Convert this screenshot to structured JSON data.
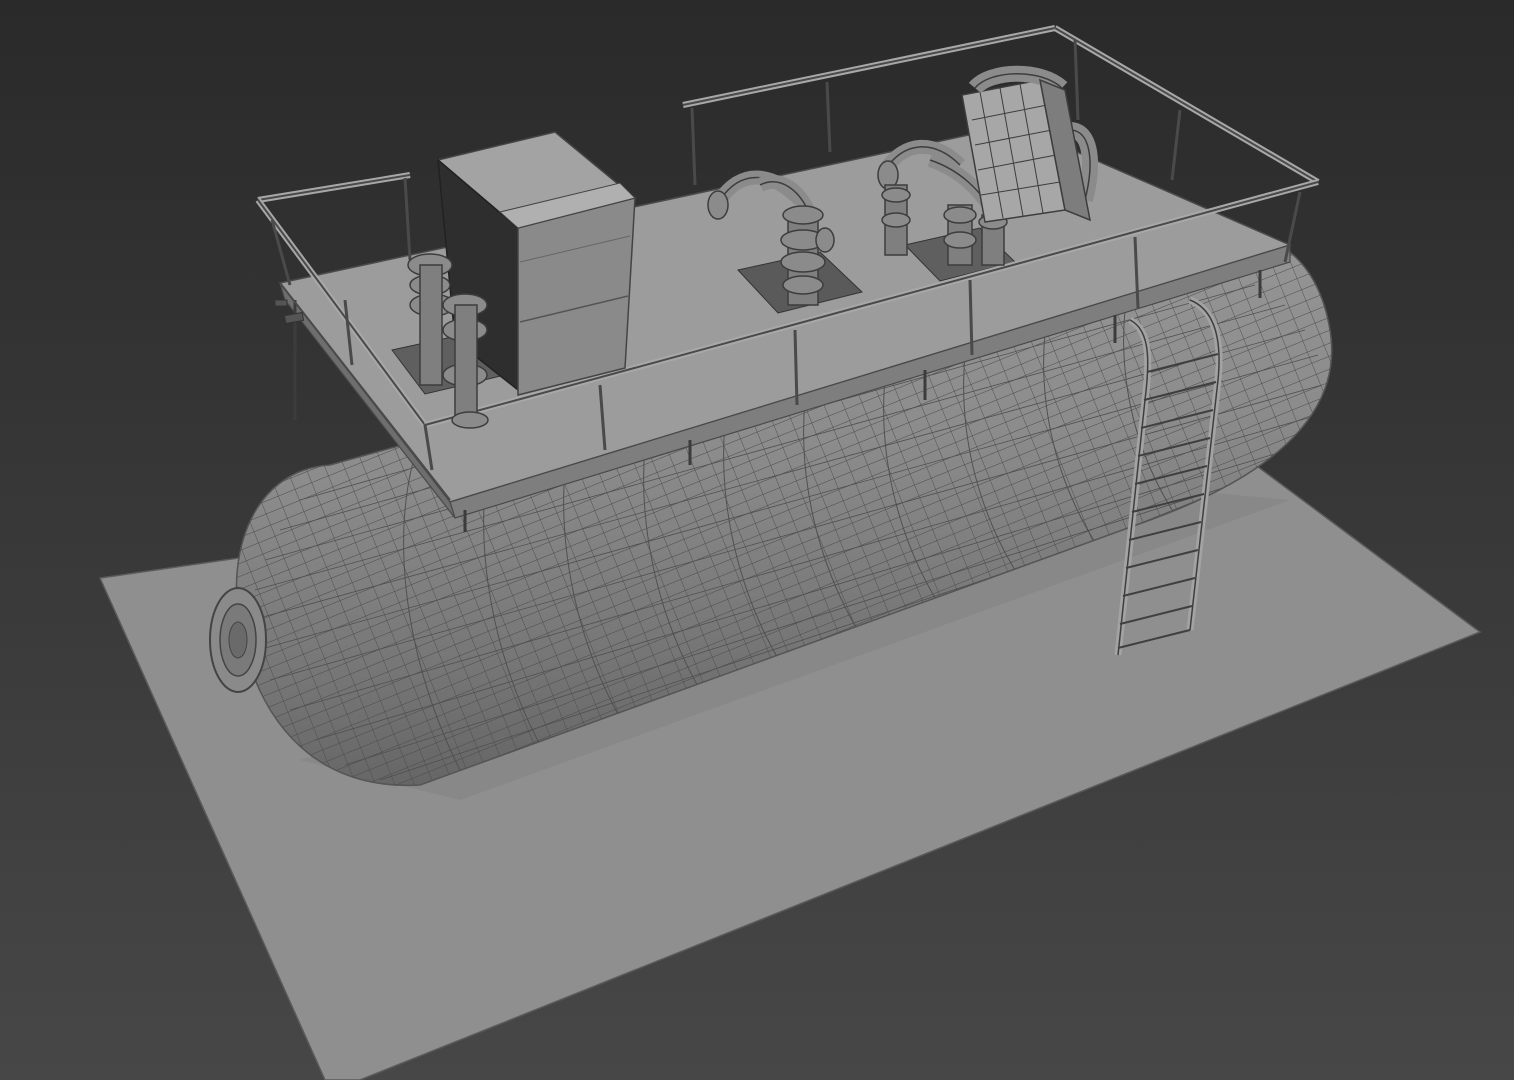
{
  "viewport": {
    "background_top": "#2a2a2a",
    "background_bottom": "#474747",
    "shading_mode": "wireframe-over-shaded",
    "wire_color": "#3a3a3a"
  },
  "scene": {
    "objects": [
      "ground-plane",
      "pressure-vessel",
      "end-flange",
      "platform-deck",
      "guard-railing",
      "electrical-cabinet",
      "valve-stack-left",
      "valve-stack-middle",
      "valve-stack-right",
      "heat-exchanger-unit",
      "access-ladder"
    ]
  }
}
